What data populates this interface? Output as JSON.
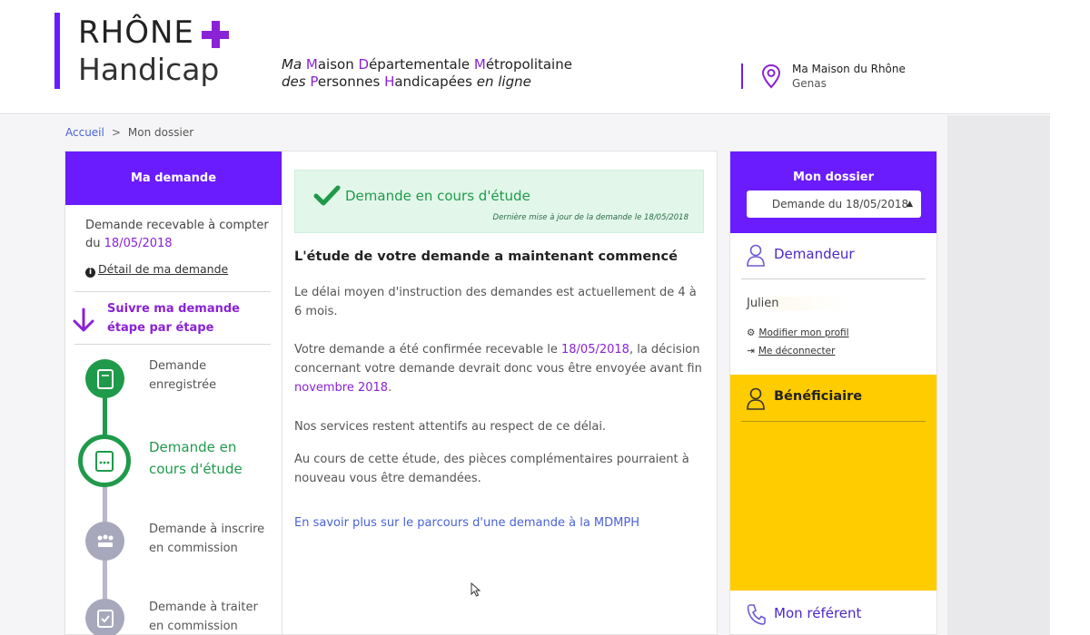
{
  "header": {
    "logo_line1": "RHÔNE",
    "logo_line2": "Handicap",
    "tagline_line1": [
      {
        "text": "Ma ",
        "style": "it"
      },
      {
        "text": "M",
        "style": "cap"
      },
      {
        "text": "aison ",
        "style": ""
      },
      {
        "text": "D",
        "style": "cap"
      },
      {
        "text": "épartementale ",
        "style": ""
      },
      {
        "text": "M",
        "style": "cap"
      },
      {
        "text": "étropolitaine",
        "style": ""
      }
    ],
    "tagline_line2": [
      {
        "text": "des ",
        "style": "it"
      },
      {
        "text": "P",
        "style": "cap"
      },
      {
        "text": "ersonnes ",
        "style": ""
      },
      {
        "text": "H",
        "style": "cap"
      },
      {
        "text": "andicapées ",
        "style": ""
      },
      {
        "text": "en ligne",
        "style": "it"
      }
    ],
    "location_name": "Ma Maison du Rhône",
    "location_city": "Genas"
  },
  "breadcrumb": {
    "home": "Accueil",
    "separator": ">",
    "current": "Mon dossier"
  },
  "left": {
    "title": "Ma demande",
    "recevable_text": "Demande recevable à compter du",
    "recevable_date": "18/05/2018",
    "detail_link": "Détail de ma demande",
    "follow_line1": "Suivre ma demande",
    "follow_line2": "étape par étape",
    "steps": [
      {
        "line1": "Demande",
        "line2": "enregistrée",
        "status": "done"
      },
      {
        "line1": "Demande en",
        "line2": "cours d'étude",
        "status": "current"
      },
      {
        "line1": "Demande à inscrire",
        "line2": "en commission",
        "status": "pending"
      },
      {
        "line1": "Demande à traiter",
        "line2": "en commission",
        "status": "pending"
      }
    ]
  },
  "main": {
    "status_title": "Demande en cours d'étude",
    "status_update": "Dernière mise à jour de la demande le 18/05/2018",
    "heading": "L'étude de votre demande a maintenant commencé",
    "p1": "Le délai moyen d'instruction des demandes est actuellement de 4 à 6 mois.",
    "p2_before": "Votre demande a été confirmée recevable le ",
    "p2_date": "18/05/2018",
    "p2_middle": ", la décision concernant votre demande devrait donc vous être envoyée avant fin ",
    "p2_deadline": "novembre 2018",
    "p2_end": ".",
    "p3": "Nos services restent attentifs au respect de ce délai.",
    "p4": "Au cours de cette étude, des pièces complémentaires pourraient à nouveau vous être demandées.",
    "link": "En savoir plus sur le parcours d'une demande à la MDMPH"
  },
  "right": {
    "title": "Mon dossier",
    "select_value": "Demande du 18/05/2018",
    "demandeur_title": "Demandeur",
    "user_name": "Julien",
    "modify_profile": "Modifier mon profil",
    "logout": "Me déconnecter",
    "beneficiaire_title": "Bénéficiaire",
    "referent_title": "Mon référent"
  },
  "colors": {
    "brand_purple": "#6a1cff",
    "accent_violet": "#8a22d6",
    "success_green": "#1f9a4a",
    "link_blue": "#4a62d8",
    "beneficiaire_yellow": "#ffcc00"
  }
}
